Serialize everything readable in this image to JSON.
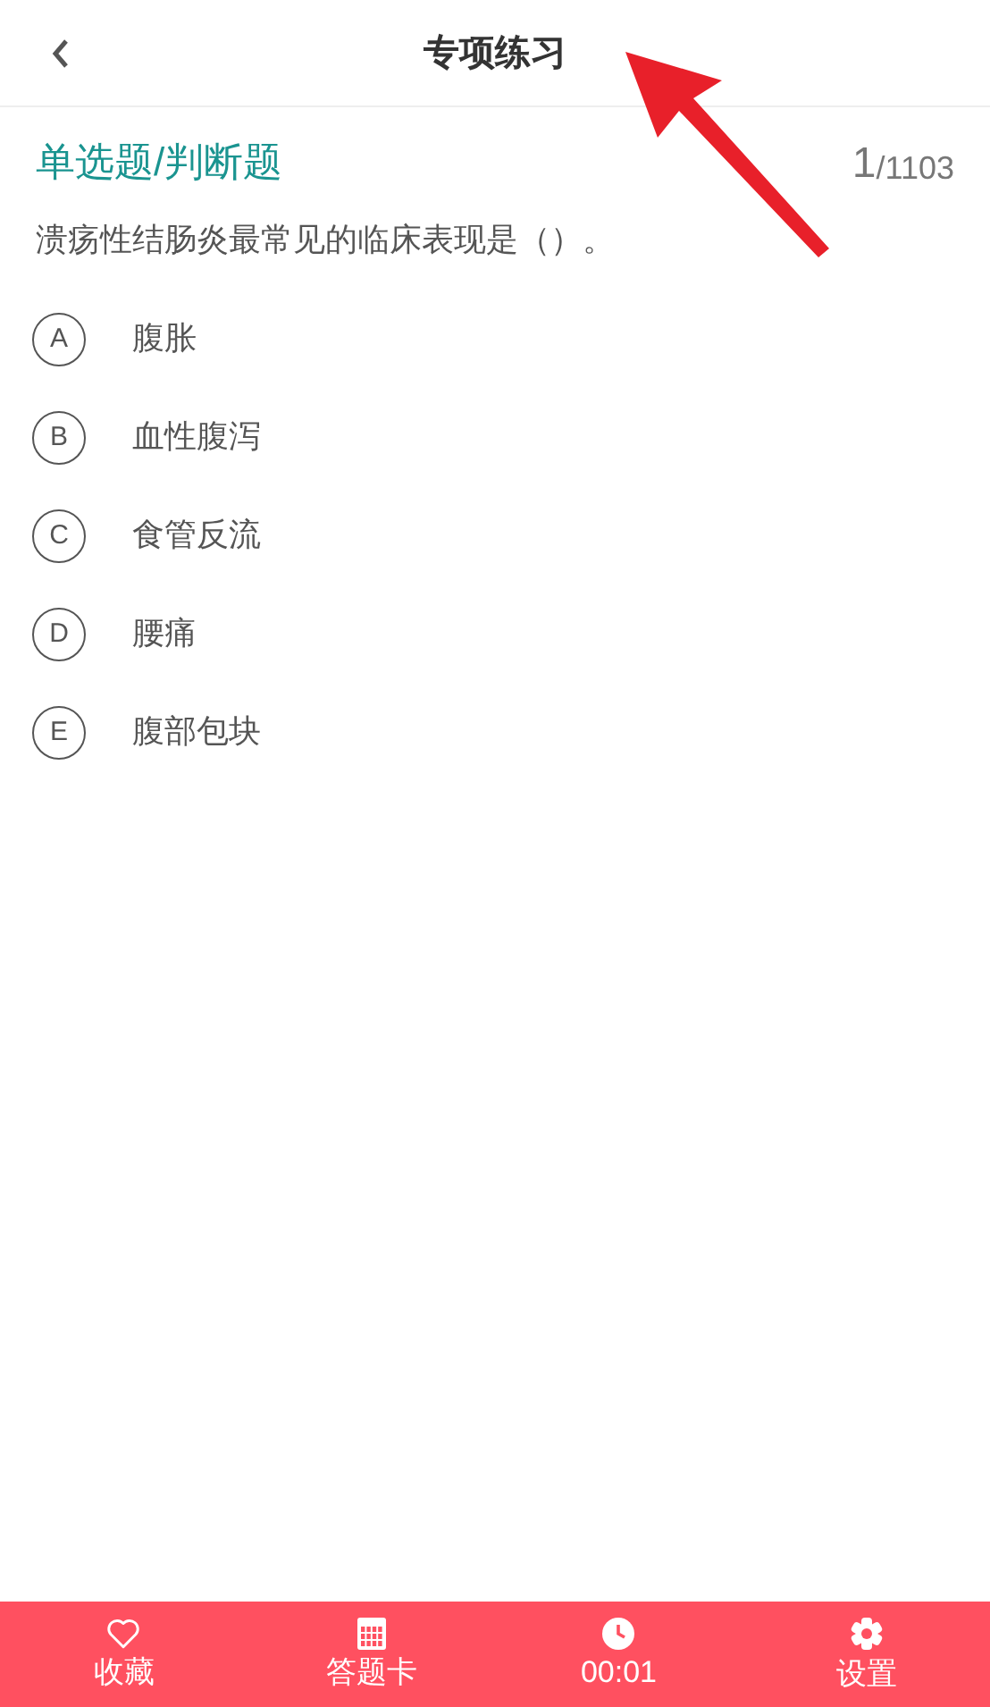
{
  "header": {
    "title": "专项练习"
  },
  "question": {
    "type_label": "单选题/判断题",
    "current": "1",
    "total": "/1103",
    "text": "溃疡性结肠炎最常见的临床表现是（）。"
  },
  "options": [
    {
      "letter": "A",
      "text": "腹胀",
      "selected": false
    },
    {
      "letter": "B",
      "text": "血性腹泻",
      "selected": false
    },
    {
      "letter": "C",
      "text": "食管反流",
      "selected": false
    },
    {
      "letter": "D",
      "text": "腰痛",
      "selected": false
    },
    {
      "letter": "E",
      "text": "腹部包块",
      "selected": false
    }
  ],
  "bottom_bar": [
    {
      "kind": "favorite",
      "label": "收藏"
    },
    {
      "kind": "answer_card",
      "label": "答题卡"
    },
    {
      "kind": "timer",
      "label": "00:01"
    },
    {
      "kind": "settings",
      "label": "设置"
    }
  ],
  "annotation": {
    "kind": "arrow"
  }
}
